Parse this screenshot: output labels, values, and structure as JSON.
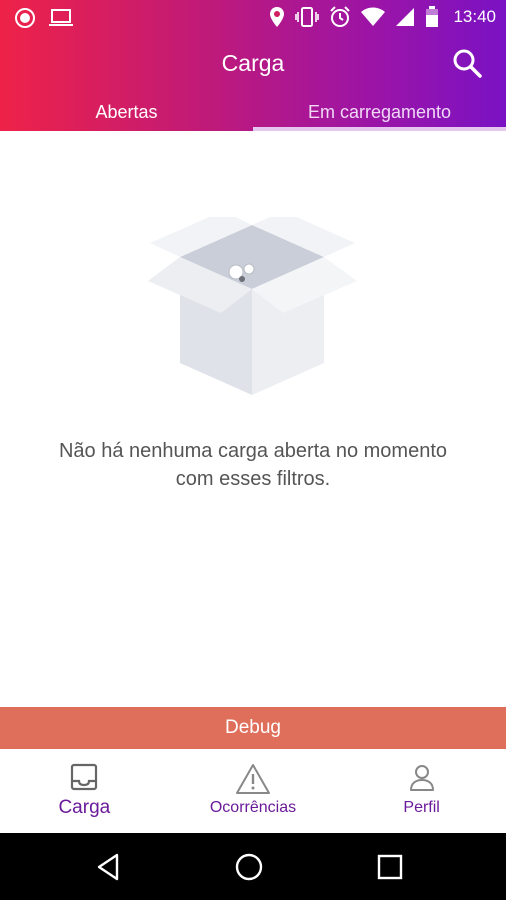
{
  "status_bar": {
    "time": "13:40",
    "left_icons": [
      "record-icon",
      "laptop-icon"
    ],
    "right_icons": [
      "location-icon",
      "vibrate-icon",
      "alarm-icon",
      "wifi-icon",
      "signal-icon",
      "battery-icon"
    ]
  },
  "toolbar": {
    "title": "Carga",
    "search_icon": "search-icon"
  },
  "tabs": [
    {
      "label": "Abertas",
      "active": false
    },
    {
      "label": "Em carregamento",
      "active": true
    }
  ],
  "empty_state": {
    "illustration": "open-box-illustration",
    "message_line1": "Não há nenhuma carga aberta no momento",
    "message_line2": "com esses filtros."
  },
  "debug_bar": {
    "label": "Debug"
  },
  "bottom_nav": {
    "items": [
      {
        "label": "Carga",
        "icon": "inbox-icon",
        "active": true
      },
      {
        "label": "Ocorrências",
        "icon": "warning-icon",
        "active": false
      },
      {
        "label": "Perfil",
        "icon": "person-icon",
        "active": false
      }
    ]
  },
  "colors": {
    "gradient_start": "#ee2248",
    "gradient_end": "#7a12c4",
    "accent_purple": "#6a1b9a",
    "debug_bar": "#df6f5a"
  }
}
